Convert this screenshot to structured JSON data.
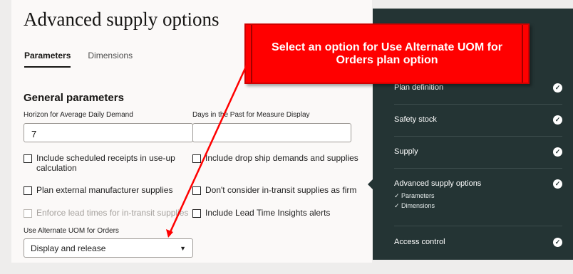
{
  "page": {
    "title": "Advanced supply options"
  },
  "tabs": [
    {
      "label": "Parameters",
      "active": true
    },
    {
      "label": "Dimensions",
      "active": false
    }
  ],
  "section": {
    "title": "General parameters"
  },
  "fields": {
    "horizon_label": "Horizon for Average Daily Demand",
    "horizon_value": "7",
    "days_past_label": "Days in the Past for Measure Display",
    "days_past_value": ""
  },
  "checkboxes": {
    "scheduled_receipts": "Include scheduled receipts in use-up calculation",
    "drop_ship": "Include drop ship demands and supplies",
    "external_mfr": "Plan external manufacturer supplies",
    "in_transit_firm": "Don't consider in-transit supplies as firm",
    "lead_times": "Enforce lead times for in-transit supplies",
    "lead_time_insights": "Include Lead Time Insights alerts"
  },
  "uom": {
    "label": "Use Alternate UOM for Orders",
    "value": "Display and release"
  },
  "steps": {
    "plan_definition": "Plan definition",
    "safety_stock": "Safety stock",
    "supply": "Supply",
    "advanced": "Advanced supply options",
    "advanced_sub": [
      "✓ Parameters",
      "✓ Dimensions"
    ],
    "access_control": "Access control"
  },
  "callout": {
    "line1": "Select an option for Use Alternate UOM for",
    "line2": "Orders plan option"
  },
  "colors": {
    "panel": "#243434",
    "callout": "#ff0000"
  }
}
